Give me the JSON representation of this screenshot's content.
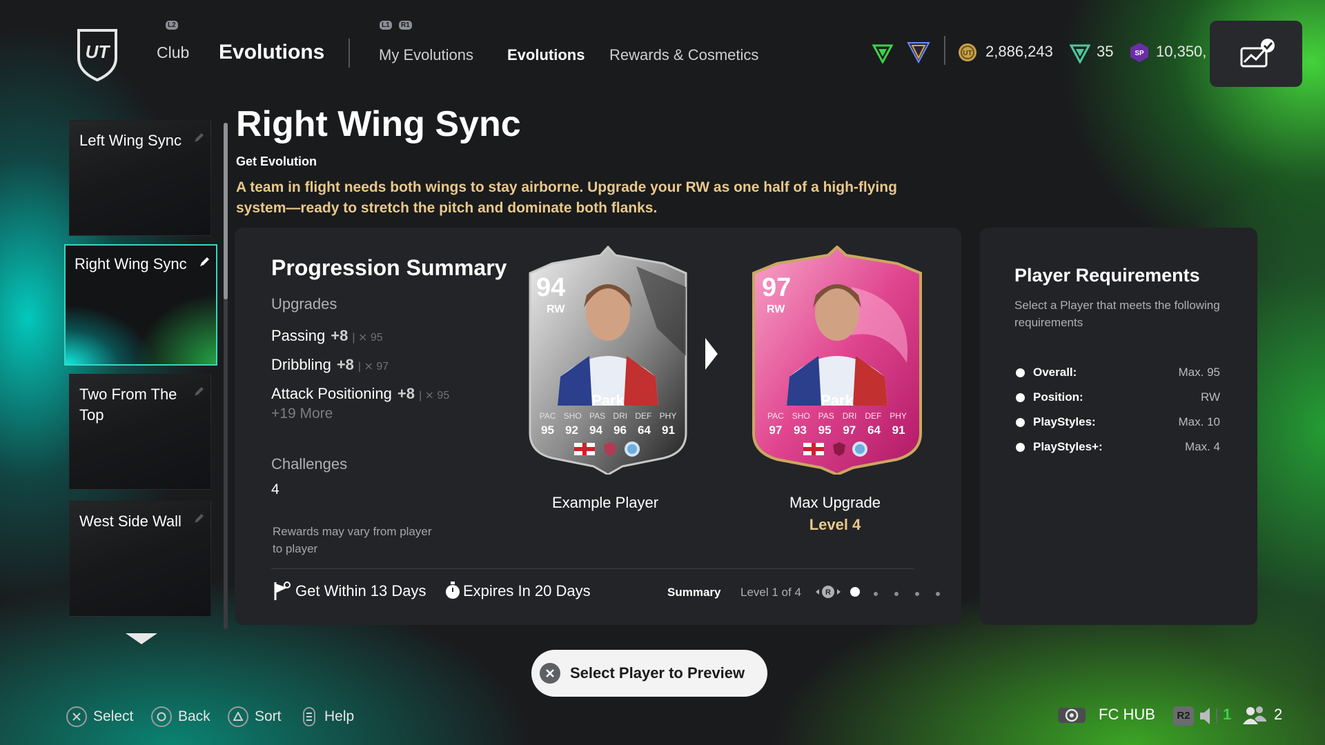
{
  "nav": {
    "club": "Club",
    "section": "Evolutions",
    "hint_l2": "L2",
    "hint_l1": "L1",
    "hint_r1": "R1",
    "tabs": [
      "My Evolutions",
      "Evolutions",
      "Rewards & Cosmetics"
    ],
    "active_tab": "Evolutions"
  },
  "currency": {
    "coins": "2,886,243",
    "points": "35",
    "sp": "10,350,",
    "sp_badge": "SP"
  },
  "sidebar": {
    "items": [
      {
        "label": "Left Wing Sync"
      },
      {
        "label": "Right Wing Sync"
      },
      {
        "label": "Two From The Top"
      },
      {
        "label": "West Side Wall"
      }
    ],
    "active_index": 1
  },
  "header": {
    "title": "Right Wing Sync",
    "subtitle": "Get Evolution",
    "description": "A team in flight needs both wings to stay airborne. Upgrade your RW as one half of a high-flying system—ready to stretch the pitch and dominate both flanks."
  },
  "progression": {
    "title": "Progression Summary",
    "upgrades_label": "Upgrades",
    "upgrades": [
      {
        "stat": "Passing",
        "plus": "+8",
        "cap": "95"
      },
      {
        "stat": "Dribbling",
        "plus": "+8",
        "cap": "97"
      },
      {
        "stat": "Attack Positioning",
        "plus": "+8",
        "cap": "95"
      }
    ],
    "more": "+19 More",
    "challenges_label": "Challenges",
    "challenges_value": "4",
    "rewards_note": "Rewards may vary from player to player",
    "get_within": "Get Within 13 Days",
    "expires": "Expires In 20 Days",
    "summary_label": "Summary",
    "level_of": "Level 1 of 4",
    "pager_button": "R",
    "pager_total": 5,
    "pager_active": 0
  },
  "cards": {
    "example": {
      "caption": "Example Player",
      "rating": "94",
      "position": "RW",
      "name": "Park",
      "stat_labels": [
        "PAC",
        "SHO",
        "PAS",
        "DRI",
        "DEF",
        "PHY"
      ],
      "stats": [
        "95",
        "92",
        "94",
        "96",
        "64",
        "91"
      ]
    },
    "max": {
      "caption": "Max Upgrade",
      "level": "Level 4",
      "rating": "97",
      "position": "RW",
      "name": "Park",
      "stat_labels": [
        "PAC",
        "SHO",
        "PAS",
        "DRI",
        "DEF",
        "PHY"
      ],
      "stats": [
        "97",
        "93",
        "95",
        "97",
        "64",
        "91"
      ]
    }
  },
  "requirements": {
    "title": "Player Requirements",
    "subtitle": "Select a Player that meets the following requirements",
    "rows": [
      {
        "label": "Overall:",
        "value": "Max. 95"
      },
      {
        "label": "Position:",
        "value": "RW"
      },
      {
        "label": "PlayStyles:",
        "value": "Max. 10"
      },
      {
        "label": "PlayStyles+:",
        "value": "Max. 4"
      }
    ]
  },
  "preview_button": "Select Player to Preview",
  "bottom": {
    "select": "Select",
    "back": "Back",
    "sort": "Sort",
    "help": "Help",
    "fc_hub": "FC HUB",
    "r2": "R2",
    "count1": "1",
    "count2": "2"
  },
  "colors": {
    "accent_gold": "#e9c98a",
    "active_border": "#37d7c3",
    "green": "#3fd04b",
    "max_card_pink": "#e0468f"
  }
}
